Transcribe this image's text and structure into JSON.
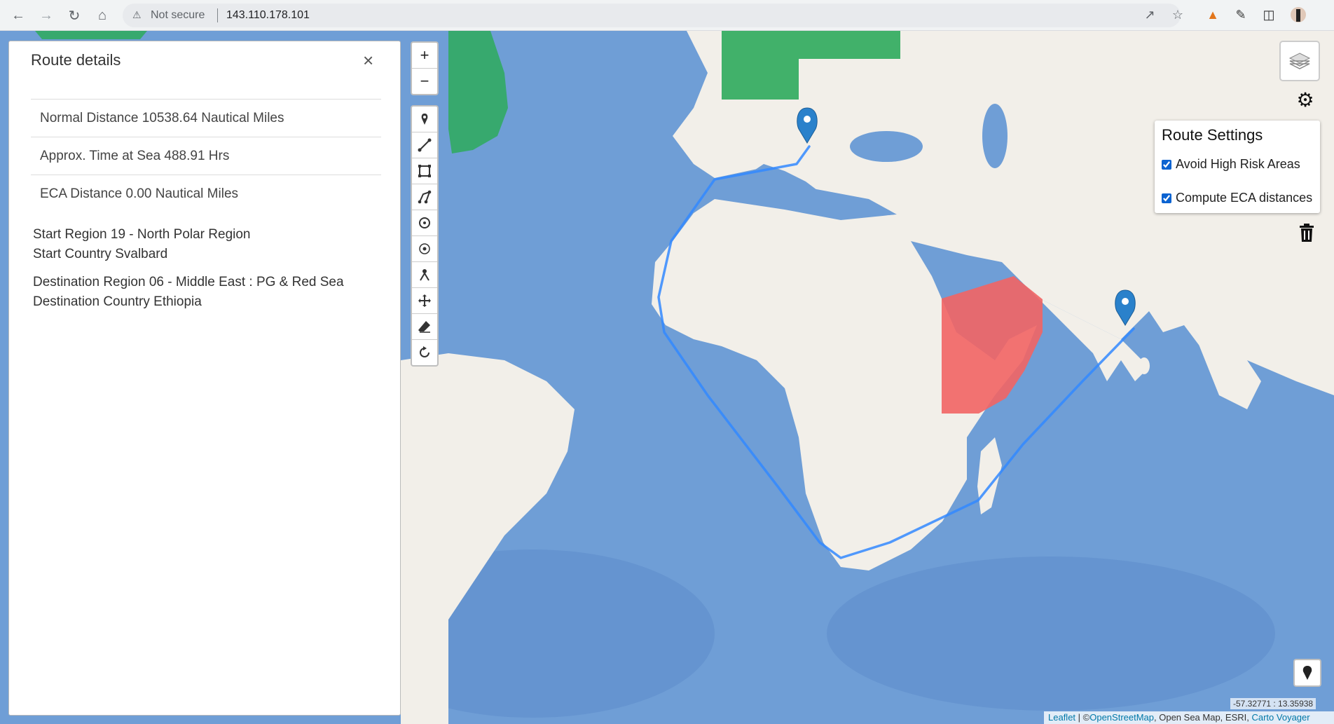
{
  "browser": {
    "security_label": "Not secure",
    "url": "143.110.178.101"
  },
  "sidebar": {
    "title": "Route details",
    "close_glyph": "×",
    "rows": [
      "Normal Distance 10538.64 Nautical Miles",
      "Approx. Time at Sea 488.91 Hrs",
      "ECA Distance 0.00 Nautical Miles"
    ],
    "start_region": "Start Region 19 - North Polar Region",
    "start_country": "Start Country Svalbard",
    "dest_region": "Destination Region 06 - Middle East : PG & Red Sea",
    "dest_country": "Destination Country Ethiopia"
  },
  "map_controls": {
    "zoom_in": "+",
    "zoom_out": "−"
  },
  "route_settings": {
    "title": "Route Settings",
    "avoid_high_risk": "Avoid High Risk Areas",
    "avoid_high_risk_checked": true,
    "compute_eca": "Compute ECA distances",
    "compute_eca_checked": true
  },
  "coordinates": "-57.32771 : 13.35938",
  "attribution": {
    "leaflet": "Leaflet",
    "separator": " | ©",
    "osm": "OpenStreetMap",
    "rest": ", Open Sea Map, ESRI, ",
    "carto": "Carto Voyager"
  },
  "colors": {
    "route": "#3388ff",
    "high_risk_area": "#f26464",
    "eca_zone": "#2eaa5c",
    "ocean": "#6f9ed6",
    "land": "#f2efe9"
  },
  "icons": [
    "back-icon",
    "forward-icon",
    "reload-icon",
    "home-icon",
    "warning-icon",
    "share-icon",
    "star-icon",
    "extension-icon",
    "sidepanel-icon",
    "profile-icon",
    "marker-icon",
    "polyline-icon",
    "rectangle-icon",
    "polygon-icon",
    "circle-icon",
    "circlemarker-icon",
    "cut-icon",
    "move-icon",
    "eraser-icon",
    "rotate-icon",
    "layers-icon",
    "gear-icon",
    "trash-icon",
    "locate-icon"
  ]
}
